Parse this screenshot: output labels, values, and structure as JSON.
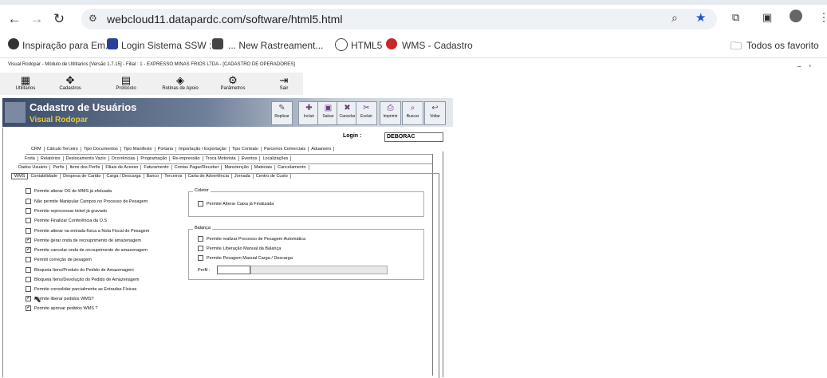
{
  "browser": {
    "url": "webcloud11.datapardc.com/software/html5.html",
    "bookmarks": [
      "Inspiração para Em...",
      "Login Sistema SSW :...",
      "... New Rastreament...",
      "HTML5",
      "WMS - Cadastro"
    ],
    "all_bookmarks": "Todos os favorito"
  },
  "window": {
    "title": "Visual Rodopar - Módulo de Utilitarios [Versão 1.7.15] - Filial : 1 - EXPRESSO MINAS FRIOS LTDA - [CADASTRO DE OPERADORES]"
  },
  "toolbar": [
    "Utilitarios",
    "Cadastros",
    "Protocolo",
    "Rotinas de Apoio",
    "Parâmetros",
    "Sair"
  ],
  "header": {
    "title": "Cadastro de Usuários",
    "subtitle": "Visual Rodopar",
    "buttons": [
      "Replicar",
      "Incluir",
      "Salvar",
      "Cancelar",
      "Excluir",
      "Imprimir",
      "Buscar",
      "Voltar"
    ]
  },
  "login": {
    "label": "Login :",
    "value": "DEBORAC"
  },
  "tabs": {
    "row1": [
      "CRM",
      "Cálculo Terceiro",
      "Tipo Documentos",
      "Tipo Manifesto",
      "Portaria",
      "Importação / Exportação",
      "Tipo Contrato",
      "Parceiros Comerciais",
      "Aduaneiro"
    ],
    "row2": [
      "Frota",
      "Relatórios",
      "Deslocamento Vazio",
      "Ocorrências",
      "Programação",
      "Re-impressão",
      "Troca Motorista",
      "Eventos",
      "Localizações"
    ],
    "row3": [
      "Dados Usuário",
      "Perfis",
      "Itens dos Perfis",
      "Filiais de Acesso",
      "Faturamento",
      "Contas Pagar/Receber",
      "Manutenção",
      "Materiais",
      "Cancelamento"
    ],
    "row4": [
      "WMS",
      "Contabilidade",
      "Despesa de Cartão",
      "Carga / Descarga",
      "Banco",
      "Terceiros",
      "Carta de Advertência",
      "Jornada",
      "Centro de Custo"
    ]
  },
  "wms": [
    {
      "label": "Permite alterar OS de WMS já efetuada",
      "checked": ""
    },
    {
      "label": "Não permite Manipular Campos no Processo de Pesagem",
      "checked": ""
    },
    {
      "label": "Permite reprocessar ticket já gravado",
      "checked": ""
    },
    {
      "label": "Permite Finalizar Conferência da O.S",
      "checked": ""
    },
    {
      "label": "Permite alterar na entrada física a Nota Fiscal de Pesagem",
      "checked": ""
    },
    {
      "label": "Permite gerar onda de recouprimento de amazenagem",
      "checked": "✔"
    },
    {
      "label": "Permite cancelar onda de recouprimento de amazenagem",
      "checked": "✔"
    },
    {
      "label": "Permiti correção de pesagem",
      "checked": ""
    },
    {
      "label": "Bloqueia Itens/Produto do Pedido de Amazenagem",
      "checked": ""
    },
    {
      "label": "Bloqueia Itens/Devolução do Pedido de Amazenagem",
      "checked": ""
    },
    {
      "label": "Permite consolidar parcialmente as Entradas Físicas",
      "checked": ""
    },
    {
      "label": "Permite liberar pedidos WMS?",
      "checked": "✔"
    },
    {
      "label": "Permite aprovar pedidos WMS ?",
      "checked": "✔"
    }
  ],
  "coletor": {
    "title": "Coletor",
    "items": [
      "Permite Alterar Caixa já Finalizada"
    ]
  },
  "balanca": {
    "title": "Balança",
    "items": [
      "Permite realizar Processo de Pesagem Automática",
      "Permite Liberação Manual da Balança",
      "Permite Pesagem Manual Carga / Descarga"
    ],
    "perfil_label": "Perfil :"
  }
}
